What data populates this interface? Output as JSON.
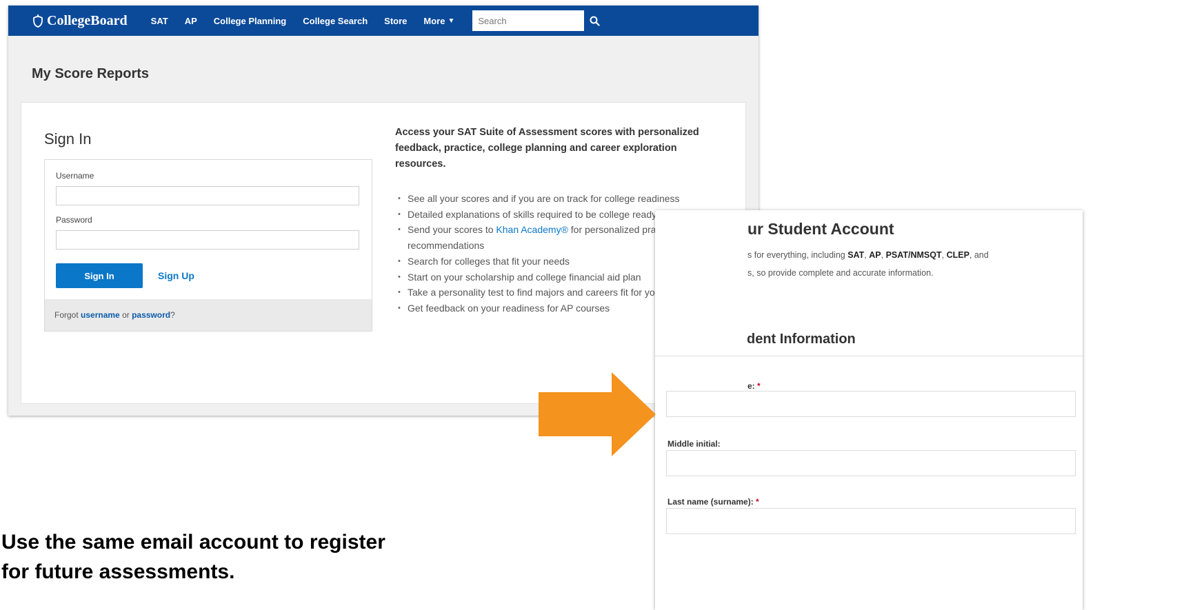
{
  "header": {
    "logo_text": "CollegeBoard",
    "nav_items": [
      {
        "label": "SAT"
      },
      {
        "label": "AP"
      },
      {
        "label": "College Planning"
      },
      {
        "label": "College Search"
      },
      {
        "label": "Store"
      },
      {
        "label": "More"
      }
    ],
    "search_placeholder": "Search"
  },
  "page": {
    "title": "My Score Reports"
  },
  "signin": {
    "title": "Sign In",
    "username_label": "Username",
    "username_value": "",
    "password_label": "Password",
    "password_value": "",
    "signin_button": "Sign In",
    "signup_link": "Sign Up",
    "forgot_prefix": "Forgot ",
    "forgot_username": "username",
    "forgot_or": " or ",
    "forgot_password": "password",
    "forgot_suffix": "?"
  },
  "info": {
    "heading": "Access your SAT Suite of Assessment scores with personalized feedback, practice, college planning and career exploration resources.",
    "benefits": [
      {
        "text": "See all your scores and if you are on track for college readiness"
      },
      {
        "text": "Detailed explanations of skills required to be college ready"
      },
      {
        "pre": "Send your scores to ",
        "link": "Khan Academy®",
        "post": " for personalized practice recommendations"
      },
      {
        "text": "Search for colleges that fit your needs"
      },
      {
        "text": "Start on your scholarship and college financial aid plan"
      },
      {
        "text": "Take a personality test to find majors and careers fit for you"
      },
      {
        "text": "Get feedback on your readiness for AP courses"
      }
    ]
  },
  "account": {
    "heading": "ur Student Account",
    "desc_1": "s for everything, including ",
    "desc_sat": "SAT",
    "desc_2": ", ",
    "desc_ap": "AP",
    "desc_3": ", ",
    "desc_psat": "PSAT/NMSQT",
    "desc_4": ", ",
    "desc_clep": "CLEP",
    "desc_5": ", and",
    "desc_line2": "s, so provide complete and accurate information.",
    "section_heading": "dent Information",
    "first_label": "e:",
    "middle_label": "Middle initial:",
    "last_label": "Last name (surname):",
    "required_mark": "*"
  },
  "caption": {
    "line1": "Use the same email account to register",
    "line2": "for future assessments."
  },
  "colors": {
    "nav_bg": "#0b4a99",
    "primary_button": "#0a77c8",
    "link": "#0a77c8",
    "arrow": "#f4931e",
    "required": "#d0021b"
  }
}
